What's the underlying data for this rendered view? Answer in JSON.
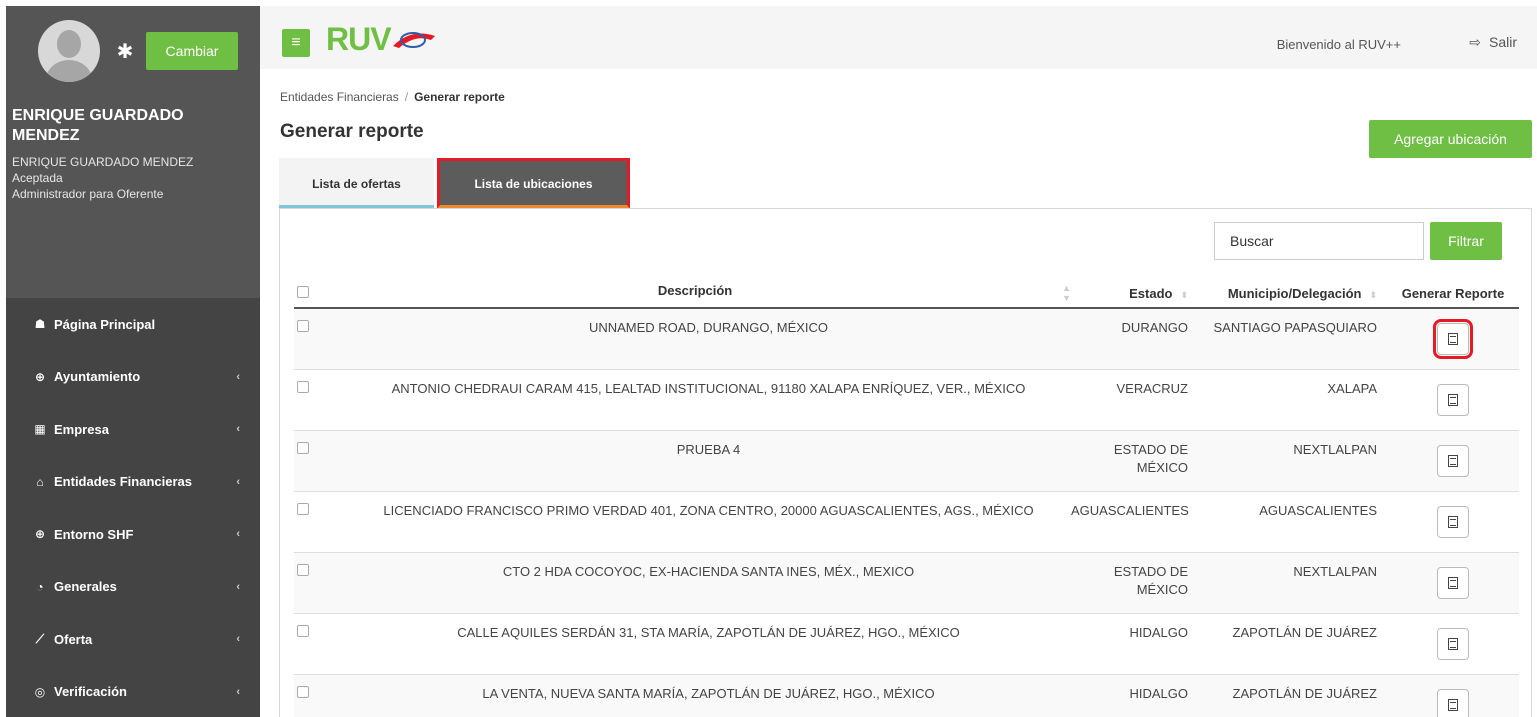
{
  "sidebar": {
    "change_label": "Cambiar",
    "user_name": "ENRIQUE GUARDADO MENDEZ",
    "user_sub_name": "ENRIQUE GUARDADO MENDEZ",
    "status": "Aceptada",
    "role": "Administrador para Oferente",
    "menu": [
      {
        "label": "Página Principal",
        "icon": "home-icon",
        "glyph": "☗",
        "has_submenu": false
      },
      {
        "label": "Ayuntamiento",
        "icon": "plus-circle-icon",
        "glyph": "⊕",
        "has_submenu": true
      },
      {
        "label": "Empresa",
        "icon": "building-icon",
        "glyph": "▦",
        "has_submenu": true
      },
      {
        "label": "Entidades Financieras",
        "icon": "bank-icon",
        "glyph": "⌂",
        "has_submenu": true
      },
      {
        "label": "Entorno SHF",
        "icon": "plus-circle-icon",
        "glyph": "⊕",
        "has_submenu": true
      },
      {
        "label": "Generales",
        "icon": "dashboard-icon",
        "glyph": "◔",
        "has_submenu": true
      },
      {
        "label": "Oferta",
        "icon": "line-chart-icon",
        "glyph": "⟋",
        "has_submenu": true
      },
      {
        "label": "Verificación",
        "icon": "target-icon",
        "glyph": "◎",
        "has_submenu": true
      }
    ]
  },
  "topbar": {
    "logo_text": "RUV",
    "welcome": "Bienvenido al RUV++",
    "logout_label": "Salir"
  },
  "breadcrumb": {
    "parent": "Entidades Financieras",
    "separator": "/",
    "current": "Generar reporte"
  },
  "page": {
    "title": "Generar reporte",
    "add_button": "Agregar ubicación"
  },
  "tabs": [
    {
      "label": "Lista de ofertas",
      "active": false
    },
    {
      "label": "Lista de ubicaciones",
      "active": true
    }
  ],
  "search": {
    "placeholder": "Buscar",
    "filter_button": "Filtrar"
  },
  "table": {
    "columns": [
      "Descripción",
      "Estado",
      "Municipio/Delegación",
      "Generar Reporte"
    ],
    "rows": [
      {
        "descripcion": "UNNAMED ROAD, DURANGO, MÉXICO",
        "estado": "DURANGO",
        "municipio": "SANTIAGO PAPASQUIARO"
      },
      {
        "descripcion": "ANTONIO CHEDRAUI CARAM 415, LEALTAD INSTITUCIONAL, 91180 XALAPA ENRÍQUEZ, VER., MÉXICO",
        "estado": "VERACRUZ",
        "municipio": "XALAPA"
      },
      {
        "descripcion": "PRUEBA 4",
        "estado": "ESTADO DE MÉXICO",
        "municipio": "NEXTLALPAN"
      },
      {
        "descripcion": "LICENCIADO FRANCISCO PRIMO VERDAD 401, ZONA CENTRO, 20000 AGUASCALIENTES, AGS., MÉXICO",
        "estado": "AGUASCALIENTES",
        "municipio": "AGUASCALIENTES"
      },
      {
        "descripcion": "CTO 2 HDA COCOYOC, EX-HACIENDA SANTA INES, MÉX., MEXICO",
        "estado": "ESTADO DE MÉXICO",
        "municipio": "NEXTLALPAN"
      },
      {
        "descripcion": "CALLE AQUILES SERDÁN 31, STA MARÍA, ZAPOTLÁN DE JUÁREZ, HGO., MÉXICO",
        "estado": "HIDALGO",
        "municipio": "ZAPOTLÁN DE JUÁREZ"
      },
      {
        "descripcion": "LA VENTA, NUEVA SANTA MARÍA, ZAPOTLÁN DE JUÁREZ, HGO., MÉXICO",
        "estado": "HIDALGO",
        "municipio": "ZAPOTLÁN DE JUÁREZ"
      }
    ]
  },
  "colors": {
    "accent_green": "#6fbf44",
    "highlight_red": "#e51a24",
    "sidebar_dark": "#444444"
  }
}
